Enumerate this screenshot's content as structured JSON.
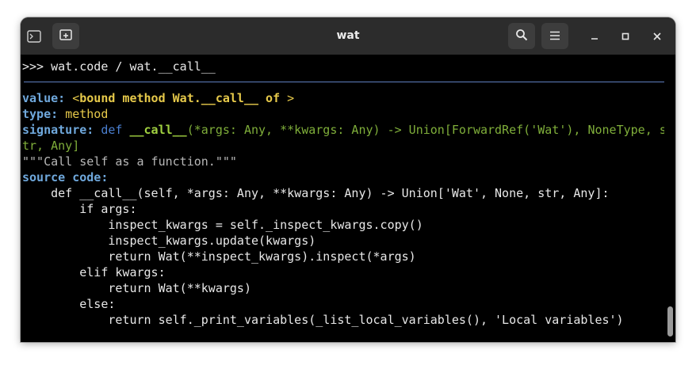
{
  "window": {
    "title": "wat",
    "buttons": {
      "terminal_icon": "terminal-icon",
      "new_tab_icon": "new-tab-icon",
      "search_icon": "search-icon",
      "menu_icon": "menu-icon",
      "minimize_icon": "minimize-icon",
      "maximize_icon": "maximize-icon",
      "close_icon": "close-icon"
    }
  },
  "terminal": {
    "prompt": ">>> wat.code / wat.__call__",
    "value_label": "value:",
    "value_lt": "<",
    "value_text": "bound method Wat.__call__ of",
    "value_gt": " >",
    "type_label": "type:",
    "type_value": "method",
    "signature_label": "signature:",
    "signature_def": "def",
    "signature_name": "__call__",
    "signature_args_1": "(*args: Any, **kwargs: Any) -> Union[ForwardRef('Wat'), NoneType, s",
    "signature_args_2": "tr, Any]",
    "docstring": "\"\"\"Call self as a function.\"\"\"",
    "source_label": "source code:",
    "source_lines": [
      "    def __call__(self, *args: Any, **kwargs: Any) -> Union['Wat', None, str, Any]:",
      "        if args:",
      "            inspect_kwargs = self._inspect_kwargs.copy()",
      "            inspect_kwargs.update(kwargs)",
      "            return Wat(**inspect_kwargs).inspect(*args)",
      "        elif kwargs:",
      "            return Wat(**kwargs)",
      "        else:",
      "            return self._print_variables(_list_local_variables(), 'Local variables')"
    ]
  }
}
